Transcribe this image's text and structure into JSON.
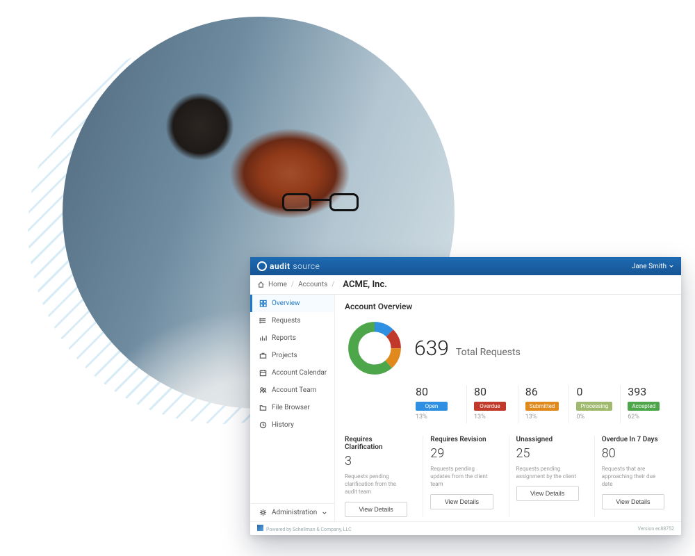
{
  "brand": {
    "part1": "audit",
    "part2": "source"
  },
  "user": {
    "name": "Jane Smith"
  },
  "breadcrumb": {
    "home": "Home",
    "accounts": "Accounts",
    "current": "ACME, Inc."
  },
  "sidebar": {
    "items": [
      {
        "label": "Overview",
        "icon": "dashboard-icon",
        "active": true
      },
      {
        "label": "Requests",
        "icon": "list-icon"
      },
      {
        "label": "Reports",
        "icon": "report-icon"
      },
      {
        "label": "Projects",
        "icon": "briefcase-icon"
      },
      {
        "label": "Account Calendar",
        "icon": "calendar-icon"
      },
      {
        "label": "Account Team",
        "icon": "team-icon"
      },
      {
        "label": "File Browser",
        "icon": "folder-icon"
      },
      {
        "label": "History",
        "icon": "clock-icon"
      }
    ],
    "admin": {
      "label": "Administration",
      "icon": "gear-icon"
    }
  },
  "main": {
    "title": "Account Overview",
    "total": {
      "value": "639",
      "label": "Total Requests"
    },
    "stats": [
      {
        "value": "80",
        "label": "Open",
        "pct": "13%",
        "color": "#2f8fe0",
        "cls": "b-open"
      },
      {
        "value": "80",
        "label": "Overdue",
        "pct": "13%",
        "color": "#c0392b",
        "cls": "b-over"
      },
      {
        "value": "86",
        "label": "Submitted",
        "pct": "13%",
        "color": "#e08a1e",
        "cls": "b-sub"
      },
      {
        "value": "0",
        "label": "Processing",
        "pct": "0%",
        "color": "#9fb96e",
        "cls": "b-proc"
      },
      {
        "value": "393",
        "label": "Accepted",
        "pct": "62%",
        "color": "#4ea64b",
        "cls": "b-acc"
      }
    ],
    "cards": [
      {
        "title": "Requires Clarification",
        "value": "3",
        "desc": "Requests pending clarification from the audit team",
        "button": "View Details"
      },
      {
        "title": "Requires Revision",
        "value": "29",
        "desc": "Requests pending updates from the client team",
        "button": "View Details"
      },
      {
        "title": "Unassigned",
        "value": "25",
        "desc": "Requests pending assignment by the client",
        "button": "View Details"
      },
      {
        "title": "Overdue In 7 Days",
        "value": "80",
        "desc": "Requests that are approaching their due date",
        "button": "View Details"
      }
    ]
  },
  "footer": {
    "powered": "Powered by Schellman & Company, LLC",
    "version": "Version ec88752"
  },
  "chart_data": {
    "type": "pie",
    "title": "Total Requests",
    "total": 639,
    "series": [
      {
        "name": "Open",
        "value": 80,
        "pct": 13,
        "color": "#2f8fe0"
      },
      {
        "name": "Overdue",
        "value": 80,
        "pct": 13,
        "color": "#c0392b"
      },
      {
        "name": "Submitted",
        "value": 86,
        "pct": 13,
        "color": "#e08a1e"
      },
      {
        "name": "Processing",
        "value": 0,
        "pct": 0,
        "color": "#9fb96e"
      },
      {
        "name": "Accepted",
        "value": 393,
        "pct": 62,
        "color": "#4ea64b"
      }
    ]
  }
}
